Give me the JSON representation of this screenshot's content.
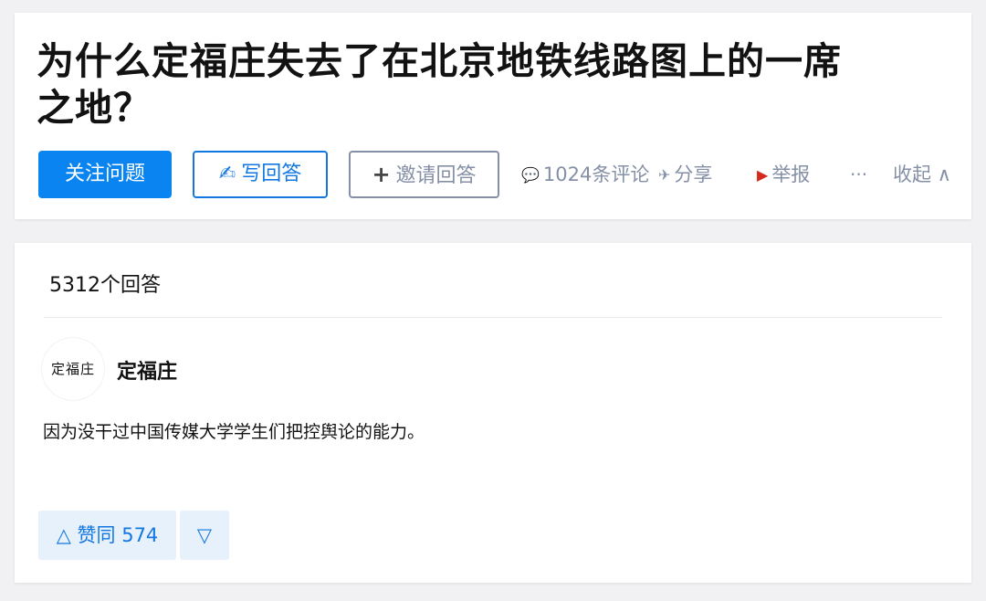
{
  "question": {
    "title": "为什么定福庄失去了在北京地铁线路图上的一席之地？",
    "follow_label": "关注问题",
    "write_icon": "✍",
    "write_label": "写回答",
    "invite_icon": "+",
    "invite_label": "邀请回答",
    "comment_icon": "💬",
    "comment_label": "1024条评论",
    "share_icon": "✈",
    "share_label": "分享",
    "report_icon": "▶",
    "report_label": "举报",
    "more_label": "···",
    "collapse_label": "收起 ∧"
  },
  "answers": {
    "count_label": "5312个回答",
    "items": [
      {
        "avatar_text": "定福庄",
        "author": "定福庄",
        "content": "因为没干过中国传媒大学学生们把控舆论的能力。",
        "upvote_label": "△ 赞同 574",
        "downvote_label": "▽"
      }
    ]
  },
  "colors": {
    "primary": "#0a84f0",
    "link_blue": "#1377e0",
    "muted": "#8590a6",
    "vote_bg": "#e7f1fc",
    "page_bg": "#f1f1f3"
  }
}
